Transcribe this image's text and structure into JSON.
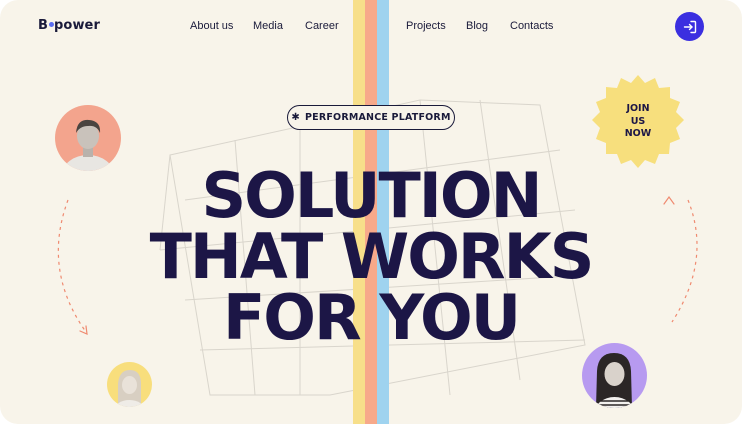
{
  "brand": {
    "logo_prefix": "B",
    "logo_suffix": "power"
  },
  "nav": {
    "items": [
      {
        "label": "About us"
      },
      {
        "label": "Media"
      },
      {
        "label": "Career"
      },
      {
        "label": "Projects"
      },
      {
        "label": "Blog"
      },
      {
        "label": "Contacts"
      }
    ],
    "login_icon": "login-arrow-icon"
  },
  "hero": {
    "badge_icon": "asterisk-icon",
    "badge_symbol": "✱",
    "badge_label": "PERFORMANCE PLATFORM",
    "headline_line1": "SOLUTION",
    "headline_line2": "THAT WORKS",
    "headline_line3": "FOR YOU"
  },
  "sticker": {
    "line1": "JOIN",
    "line2": "US",
    "line3": "NOW"
  },
  "colors": {
    "background": "#f8f4ea",
    "ink": "#1c1646",
    "accent_blue": "#3b2fe0",
    "stripe_yellow": "#f7df8a",
    "stripe_orange": "#f7a98a",
    "stripe_blue": "#9fd3ef",
    "sticker_yellow": "#f7df7d",
    "avatar_salmon": "#f3a48d",
    "avatar_yellow": "#f8de7c",
    "avatar_purple": "#b79af0"
  }
}
